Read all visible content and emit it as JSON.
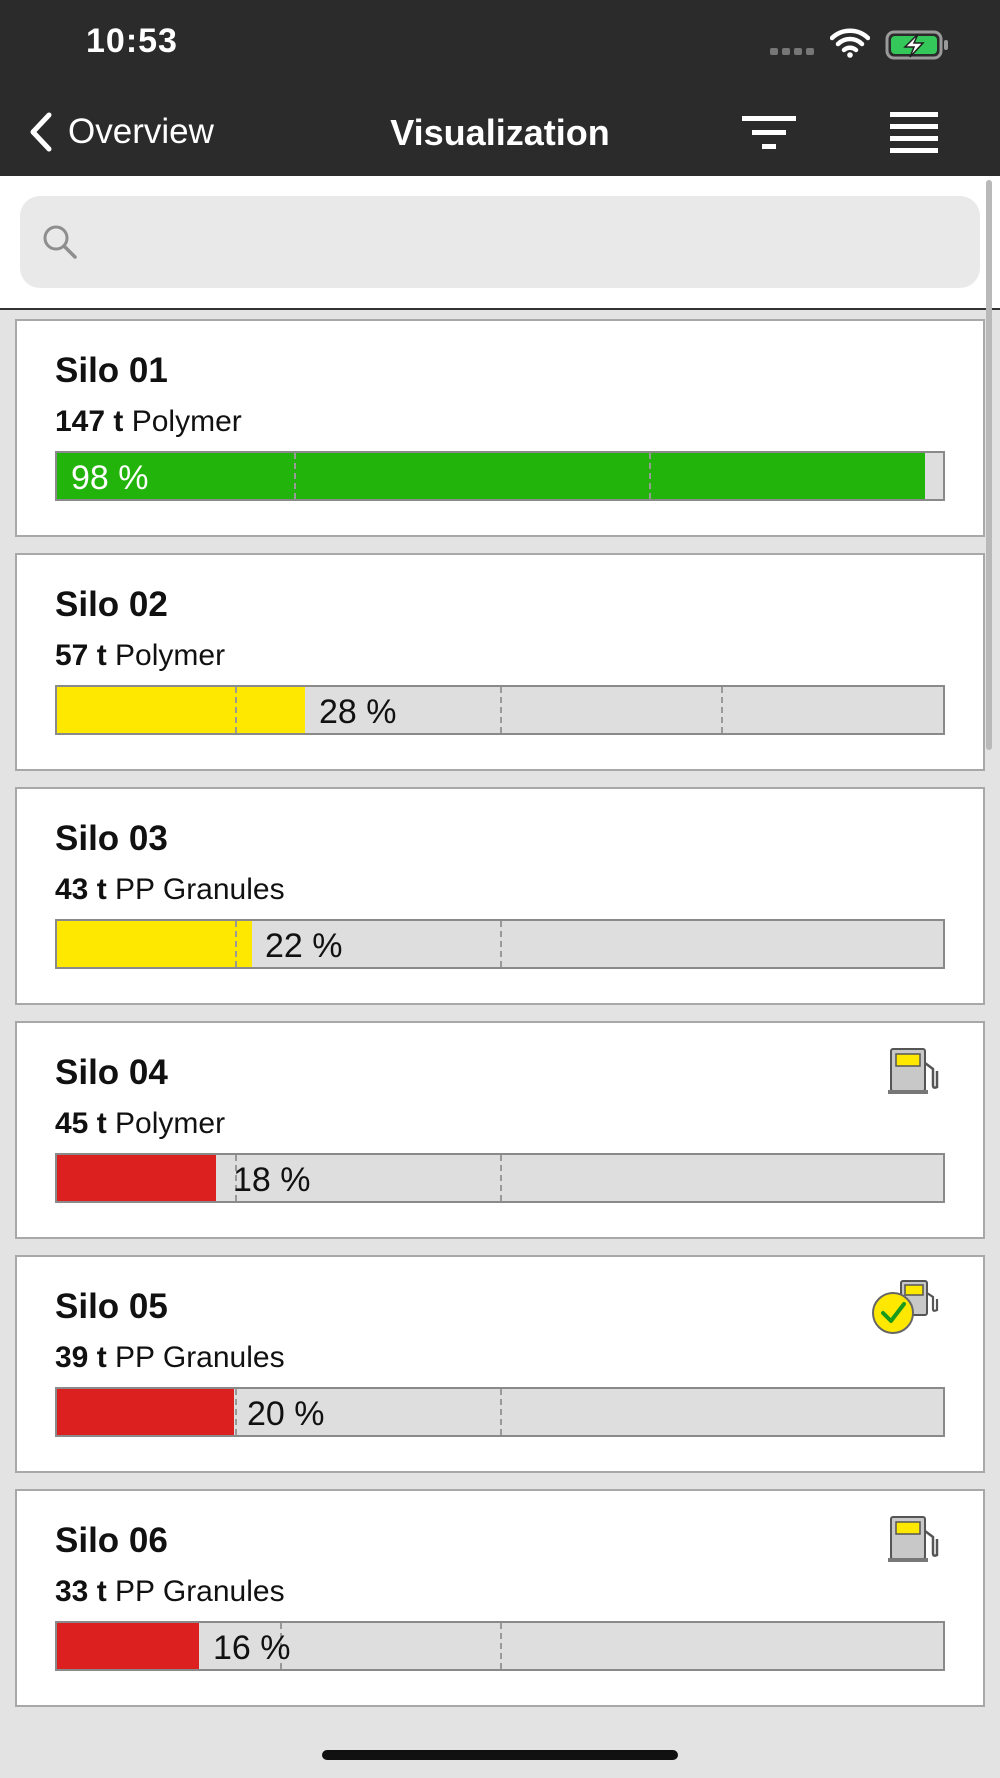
{
  "status_bar": {
    "time": "10:53"
  },
  "nav": {
    "back_label": "Overview",
    "title": "Visualization"
  },
  "search": {
    "placeholder": "",
    "value": ""
  },
  "colors": {
    "green": "#22b40a",
    "yellow": "#ffe800",
    "red": "#dc1f1f",
    "header_bg": "#2b2b2b"
  },
  "silos": [
    {
      "name": "Silo 01",
      "quantity": "147 t",
      "material": "Polymer",
      "percent_label": "98 %",
      "fill_level": 0.98,
      "status_color": "green",
      "icon": null
    },
    {
      "name": "Silo 02",
      "quantity": "57 t",
      "material": "Polymer",
      "percent_label": "28 %",
      "fill_level": 0.28,
      "status_color": "yellow",
      "icon": null
    },
    {
      "name": "Silo 03",
      "quantity": "43 t",
      "material": "PP Granules",
      "percent_label": "22 %",
      "fill_level": 0.22,
      "status_color": "yellow",
      "icon": null
    },
    {
      "name": "Silo 04",
      "quantity": "45 t",
      "material": "Polymer",
      "percent_label": "18 %",
      "fill_level": 0.18,
      "status_color": "red",
      "icon": "fuel-pump-icon"
    },
    {
      "name": "Silo 05",
      "quantity": "39 t",
      "material": "PP Granules",
      "percent_label": "20 %",
      "fill_level": 0.2,
      "status_color": "red",
      "icon": "fuel-pump-confirmed-icon"
    },
    {
      "name": "Silo 06",
      "quantity": "33 t",
      "material": "PP Granules",
      "percent_label": "16 %",
      "fill_level": 0.16,
      "status_color": "red",
      "icon": "fuel-pump-icon"
    }
  ]
}
